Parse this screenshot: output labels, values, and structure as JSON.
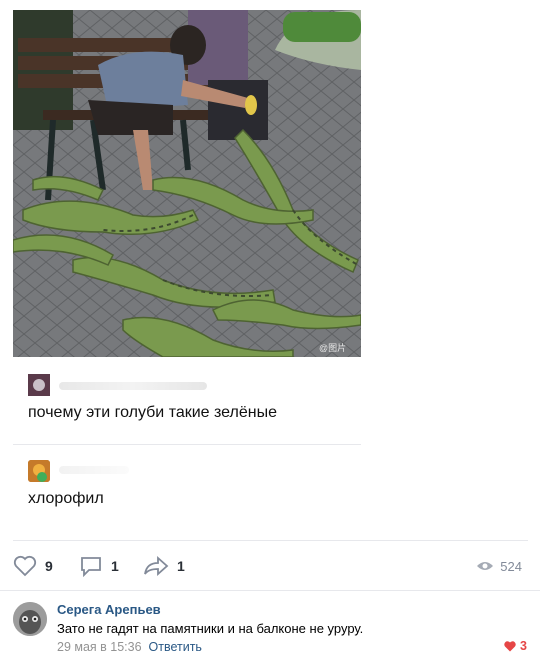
{
  "post": {
    "photo": {
      "watermark": "@图片"
    },
    "comments": [
      {
        "text": "почему эти голуби такие зелёные"
      },
      {
        "text": "хлорофил"
      }
    ]
  },
  "actions": {
    "likes": "9",
    "comments": "1",
    "shares": "1",
    "views": "524"
  },
  "reply": {
    "author": "Серега Арепьев",
    "text": "Зато не гадят на памятники и на балконе не уруру.",
    "date": "29 мая в 15:36",
    "answer_label": "Ответить",
    "likes": "3"
  },
  "colors": {
    "link": "#2a5885",
    "muted": "#828a99",
    "like_red": "#e64646",
    "iguana_green": "#7a9a4e"
  }
}
